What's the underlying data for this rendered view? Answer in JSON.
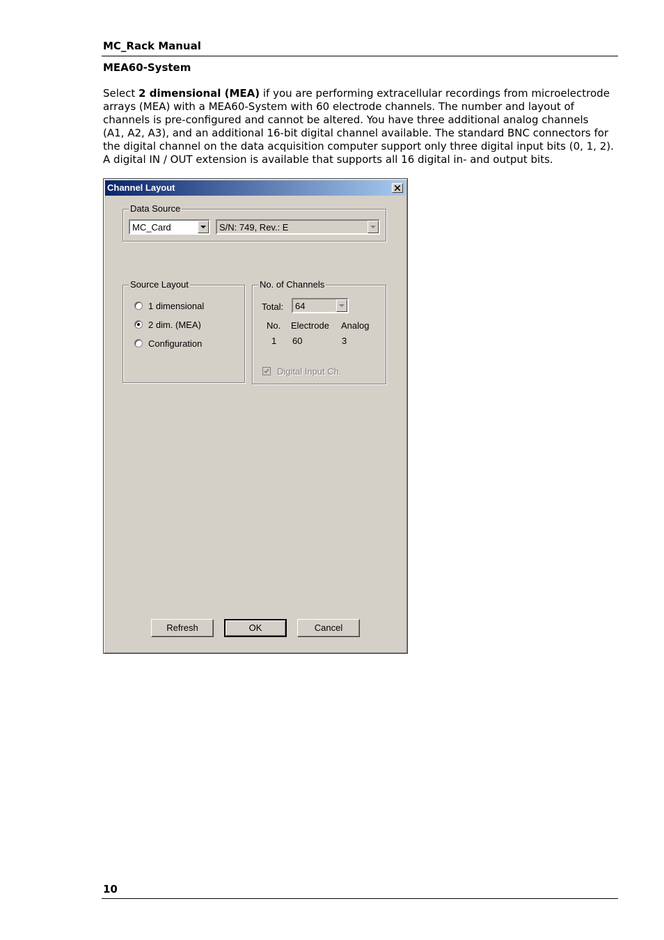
{
  "header": {
    "title": "MC_Rack Manual"
  },
  "section": {
    "title": "MEA60-System"
  },
  "paragraph": {
    "line1_pre": "Select ",
    "line1_bold": "2 dimensional (MEA)",
    "line1_post": " if you are performing extracellular recordings from microelectrode",
    "lines": [
      "arrays (MEA) with a MEA60-System with 60 electrode channels. The number and layout of",
      "channels is pre-configured and cannot be altered. You have three additional analog channels",
      "(A1, A2, A3), and an additional 16-bit digital channel available. The standard BNC connectors for",
      "the digital channel on the data acquisition computer support only three digital input bits (0, 1, 2).",
      "A digital IN / OUT extension is available that supports all 16 digital in- and output bits."
    ]
  },
  "dialog": {
    "title": "Channel Layout",
    "data_source": {
      "legend": "Data Source",
      "source_value": "MC_Card",
      "serial_value": "S/N: 749, Rev.: E"
    },
    "source_layout": {
      "legend": "Source Layout",
      "options": [
        "1 dimensional",
        "2 dim. (MEA)",
        "Configuration"
      ],
      "selected": "2 dim. (MEA)"
    },
    "channels": {
      "legend": "No. of Channels",
      "total_label": "Total:",
      "total_value": "64",
      "headers": [
        "No.",
        "Electrode",
        "Analog"
      ],
      "values": [
        "1",
        "60",
        "3"
      ],
      "digital_label": "Digital Input Ch.",
      "digital_checked": true
    },
    "buttons": {
      "refresh": "Refresh",
      "ok": "OK",
      "cancel": "Cancel"
    }
  },
  "footer": {
    "page_number": "10"
  }
}
